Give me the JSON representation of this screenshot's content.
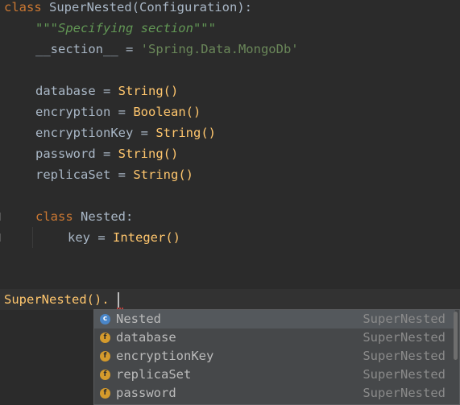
{
  "code": {
    "line1": {
      "kw": "class",
      "name": "SuperNested",
      "open": "(",
      "base": "Configuration",
      "close": "):"
    },
    "line2": {
      "doc": "\"\"\"Specifying section\"\"\""
    },
    "line3": {
      "ident": "__section__",
      "eq": " = ",
      "str": "'Spring.Data.MongoDb'"
    },
    "fields": [
      {
        "name": "database",
        "eq": " = ",
        "type": "String",
        "call": "()"
      },
      {
        "name": "encryption",
        "eq": " = ",
        "type": "Boolean",
        "call": "()"
      },
      {
        "name": "encryptionKey",
        "eq": " = ",
        "type": "String",
        "call": "()"
      },
      {
        "name": "password",
        "eq": " = ",
        "type": "String",
        "call": "()"
      },
      {
        "name": "replicaSet",
        "eq": " = ",
        "type": "String",
        "call": "()"
      }
    ],
    "nested": {
      "kw": "class",
      "name": "Nested",
      "colon": ":"
    },
    "nested_field": {
      "name": "key",
      "eq": " = ",
      "type": "Integer",
      "call": "()"
    },
    "typed": "SuperNested()."
  },
  "completion": {
    "items": [
      {
        "icon": "c",
        "name": "Nested",
        "type": "SuperNested",
        "selected": true
      },
      {
        "icon": "f",
        "name": "database",
        "type": "SuperNested"
      },
      {
        "icon": "f",
        "name": "encryptionKey",
        "type": "SuperNested"
      },
      {
        "icon": "f",
        "name": "replicaSet",
        "type": "SuperNested"
      },
      {
        "icon": "f",
        "name": "password",
        "type": "SuperNested"
      }
    ]
  },
  "colors": {
    "background": "#2b2b2b",
    "keyword": "#cc7832",
    "builtin": "#ffc66d",
    "string": "#6a8759",
    "docstring": "#629755",
    "popup": "#46484a",
    "selected": "#54585c"
  }
}
